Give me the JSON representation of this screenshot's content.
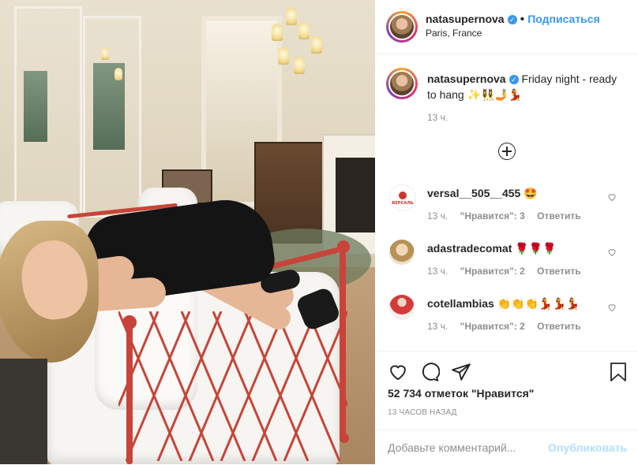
{
  "post": {
    "username": "natasupernova",
    "follow_label": "Подписаться",
    "location": "Paris, France",
    "separator": "•"
  },
  "caption": {
    "username": "natasupernova",
    "text": "Friday night - ready to hang ✨👯‍♀️🤳💃",
    "time": "13 ч."
  },
  "comments": [
    {
      "username": "versal__505__455",
      "text": "🤩",
      "time": "13 ч.",
      "likes": "\"Нравится\": 3",
      "reply": "Ответить"
    },
    {
      "username": "adastradecomat",
      "text": "🌹🌹🌹",
      "time": "13 ч.",
      "likes": "\"Нравится\": 2",
      "reply": "Ответить"
    },
    {
      "username": "cotellambias",
      "text": "👏👏👏💃💃💃",
      "time": "13 ч.",
      "likes": "\"Нравится\": 2",
      "reply": "Ответить"
    }
  ],
  "commenter_avatar_text": "ВЕРСАЛЬ",
  "stats": {
    "likes": "52 734 отметок \"Нравится\"",
    "posted": "13 ЧАСОВ НАЗАД"
  },
  "add_comment": {
    "placeholder": "Добавьте комментарий...",
    "publish_label": "Опубликовать"
  },
  "icons": {
    "verified": "verified-badge-icon",
    "like": "heart-icon",
    "comment": "comment-bubble-icon",
    "share": "paper-plane-icon",
    "save": "bookmark-icon",
    "more": "plus-circle-icon"
  },
  "colors": {
    "accent": "#3897f0",
    "publish_disabled": "#b2dffc",
    "muted": "#8e8e8e",
    "text": "#262626"
  }
}
